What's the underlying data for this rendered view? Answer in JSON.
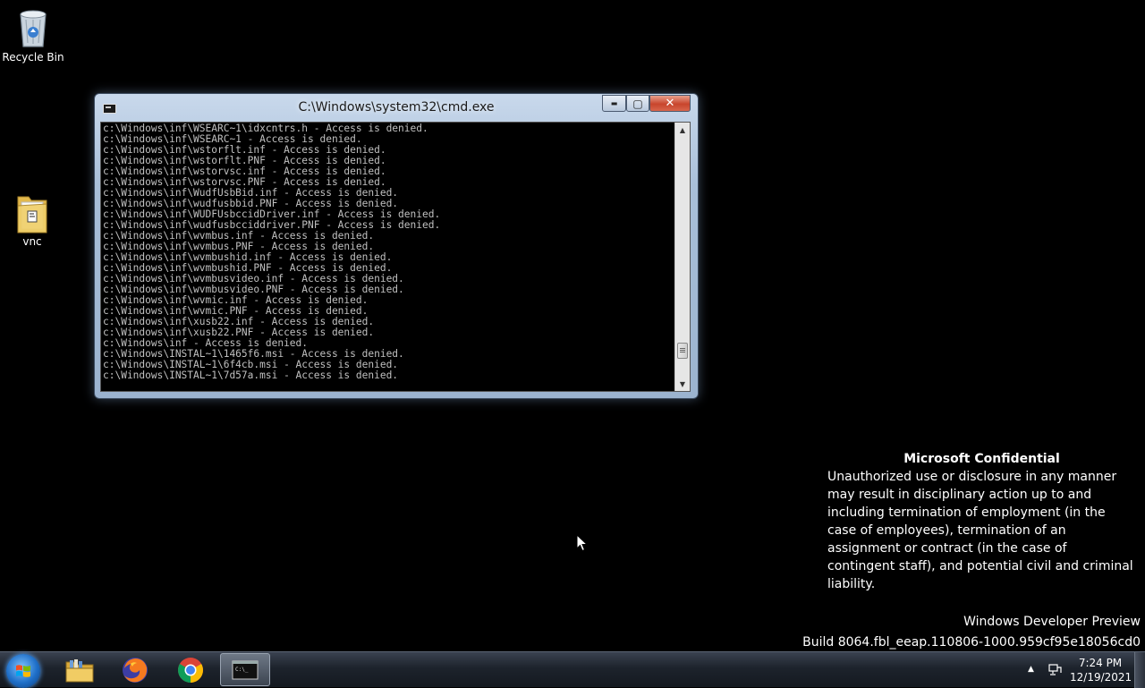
{
  "desktop": {
    "icons": [
      {
        "label": "Recycle Bin"
      },
      {
        "label": "vnc"
      }
    ]
  },
  "cmd_window": {
    "title": "C:\\Windows\\system32\\cmd.exe",
    "minimize_symbol": "▬",
    "maximize_symbol": "▢",
    "close_symbol": "✕",
    "lines": [
      "c:\\Windows\\inf\\WSEARC~1\\idxcntrs.h - Access is denied.",
      "c:\\Windows\\inf\\WSEARC~1 - Access is denied.",
      "c:\\Windows\\inf\\wstorflt.inf - Access is denied.",
      "c:\\Windows\\inf\\wstorflt.PNF - Access is denied.",
      "c:\\Windows\\inf\\wstorvsc.inf - Access is denied.",
      "c:\\Windows\\inf\\wstorvsc.PNF - Access is denied.",
      "c:\\Windows\\inf\\WudfUsbBid.inf - Access is denied.",
      "c:\\Windows\\inf\\wudfusbbid.PNF - Access is denied.",
      "c:\\Windows\\inf\\WUDFUsbccidDriver.inf - Access is denied.",
      "c:\\Windows\\inf\\wudfusbcciddriver.PNF - Access is denied.",
      "c:\\Windows\\inf\\wvmbus.inf - Access is denied.",
      "c:\\Windows\\inf\\wvmbus.PNF - Access is denied.",
      "c:\\Windows\\inf\\wvmbushid.inf - Access is denied.",
      "c:\\Windows\\inf\\wvmbushid.PNF - Access is denied.",
      "c:\\Windows\\inf\\wvmbusvideo.inf - Access is denied.",
      "c:\\Windows\\inf\\wvmbusvideo.PNF - Access is denied.",
      "c:\\Windows\\inf\\wvmic.inf - Access is denied.",
      "c:\\Windows\\inf\\wvmic.PNF - Access is denied.",
      "c:\\Windows\\inf\\xusb22.inf - Access is denied.",
      "c:\\Windows\\inf\\xusb22.PNF - Access is denied.",
      "c:\\Windows\\inf - Access is denied.",
      "c:\\Windows\\INSTAL~1\\1465f6.msi - Access is denied.",
      "c:\\Windows\\INSTAL~1\\6f4cb.msi - Access is denied.",
      "c:\\Windows\\INSTAL~1\\7d57a.msi - Access is denied."
    ],
    "scroll_position": 0.92
  },
  "notice": {
    "heading": "Microsoft Confidential",
    "body": "Unauthorized use or disclosure in any manner may result in disciplinary action up to and including termination of employment (in the case of employees), termination of an assignment or contract (in the case of contingent staff), and potential civil and criminal liability."
  },
  "watermark": {
    "line1": "Windows Developer Preview",
    "line2": "Build 8064.fbl_eeap.110806-1000.959cf95e18056cd0"
  },
  "taskbar": {
    "pinned": [
      {
        "name": "file-explorer",
        "icon": "folder-icon"
      },
      {
        "name": "firefox",
        "icon": "firefox-icon"
      },
      {
        "name": "chrome",
        "icon": "chrome-icon"
      },
      {
        "name": "command-prompt",
        "icon": "cmd-icon",
        "active": true
      }
    ],
    "tray_arrow": "▲",
    "time": "7:24 PM",
    "date": "12/19/2021"
  },
  "colors": {
    "desktop_bg": "#000000",
    "console_text": "#c0c0c0",
    "close_button": "#c8452c"
  }
}
